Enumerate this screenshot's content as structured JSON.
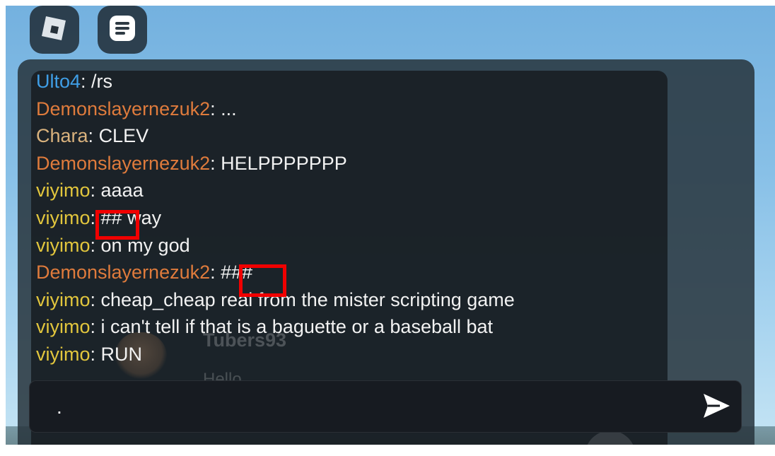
{
  "topbar": {
    "roblox_icon": "roblox-logo-icon",
    "chat_icon": "chat-icon"
  },
  "chat": {
    "messages": [
      {
        "author": "Ulto4",
        "text": "/rs",
        "color": "#3f9ee6"
      },
      {
        "author": "Demonslayernezuk2",
        "text": "...",
        "color": "#df7b3c"
      },
      {
        "author": "Chara",
        "text": "CLEV",
        "color": "#d9b27d"
      },
      {
        "author": "Demonslayernezuk2",
        "text": "HELPPPPPPP",
        "color": "#df7b3c"
      },
      {
        "author": "viyimo",
        "text": "aaaa",
        "color": "#e2c63d"
      },
      {
        "author": "viyimo",
        "text": "## way",
        "color": "#e2c63d"
      },
      {
        "author": "viyimo",
        "text": "on my god",
        "color": "#e2c63d"
      },
      {
        "author": "Demonslayernezuk2",
        "text": "###",
        "color": "#df7b3c"
      },
      {
        "author": "viyimo",
        "text": "cheap_cheap real from the mister scripting game",
        "color": "#e2c63d"
      },
      {
        "author": "viyimo",
        "text": "i can't tell if that is a baguette or a baseball bat",
        "color": "#e2c63d"
      },
      {
        "author": "viyimo",
        "text": "RUN",
        "color": "#e2c63d"
      }
    ],
    "ghost_name": "Tubers93",
    "ghost_message": "Hello"
  },
  "input": {
    "value": ".",
    "send_icon": "send-icon"
  },
  "colors": {
    "highlight": "#f10000"
  }
}
